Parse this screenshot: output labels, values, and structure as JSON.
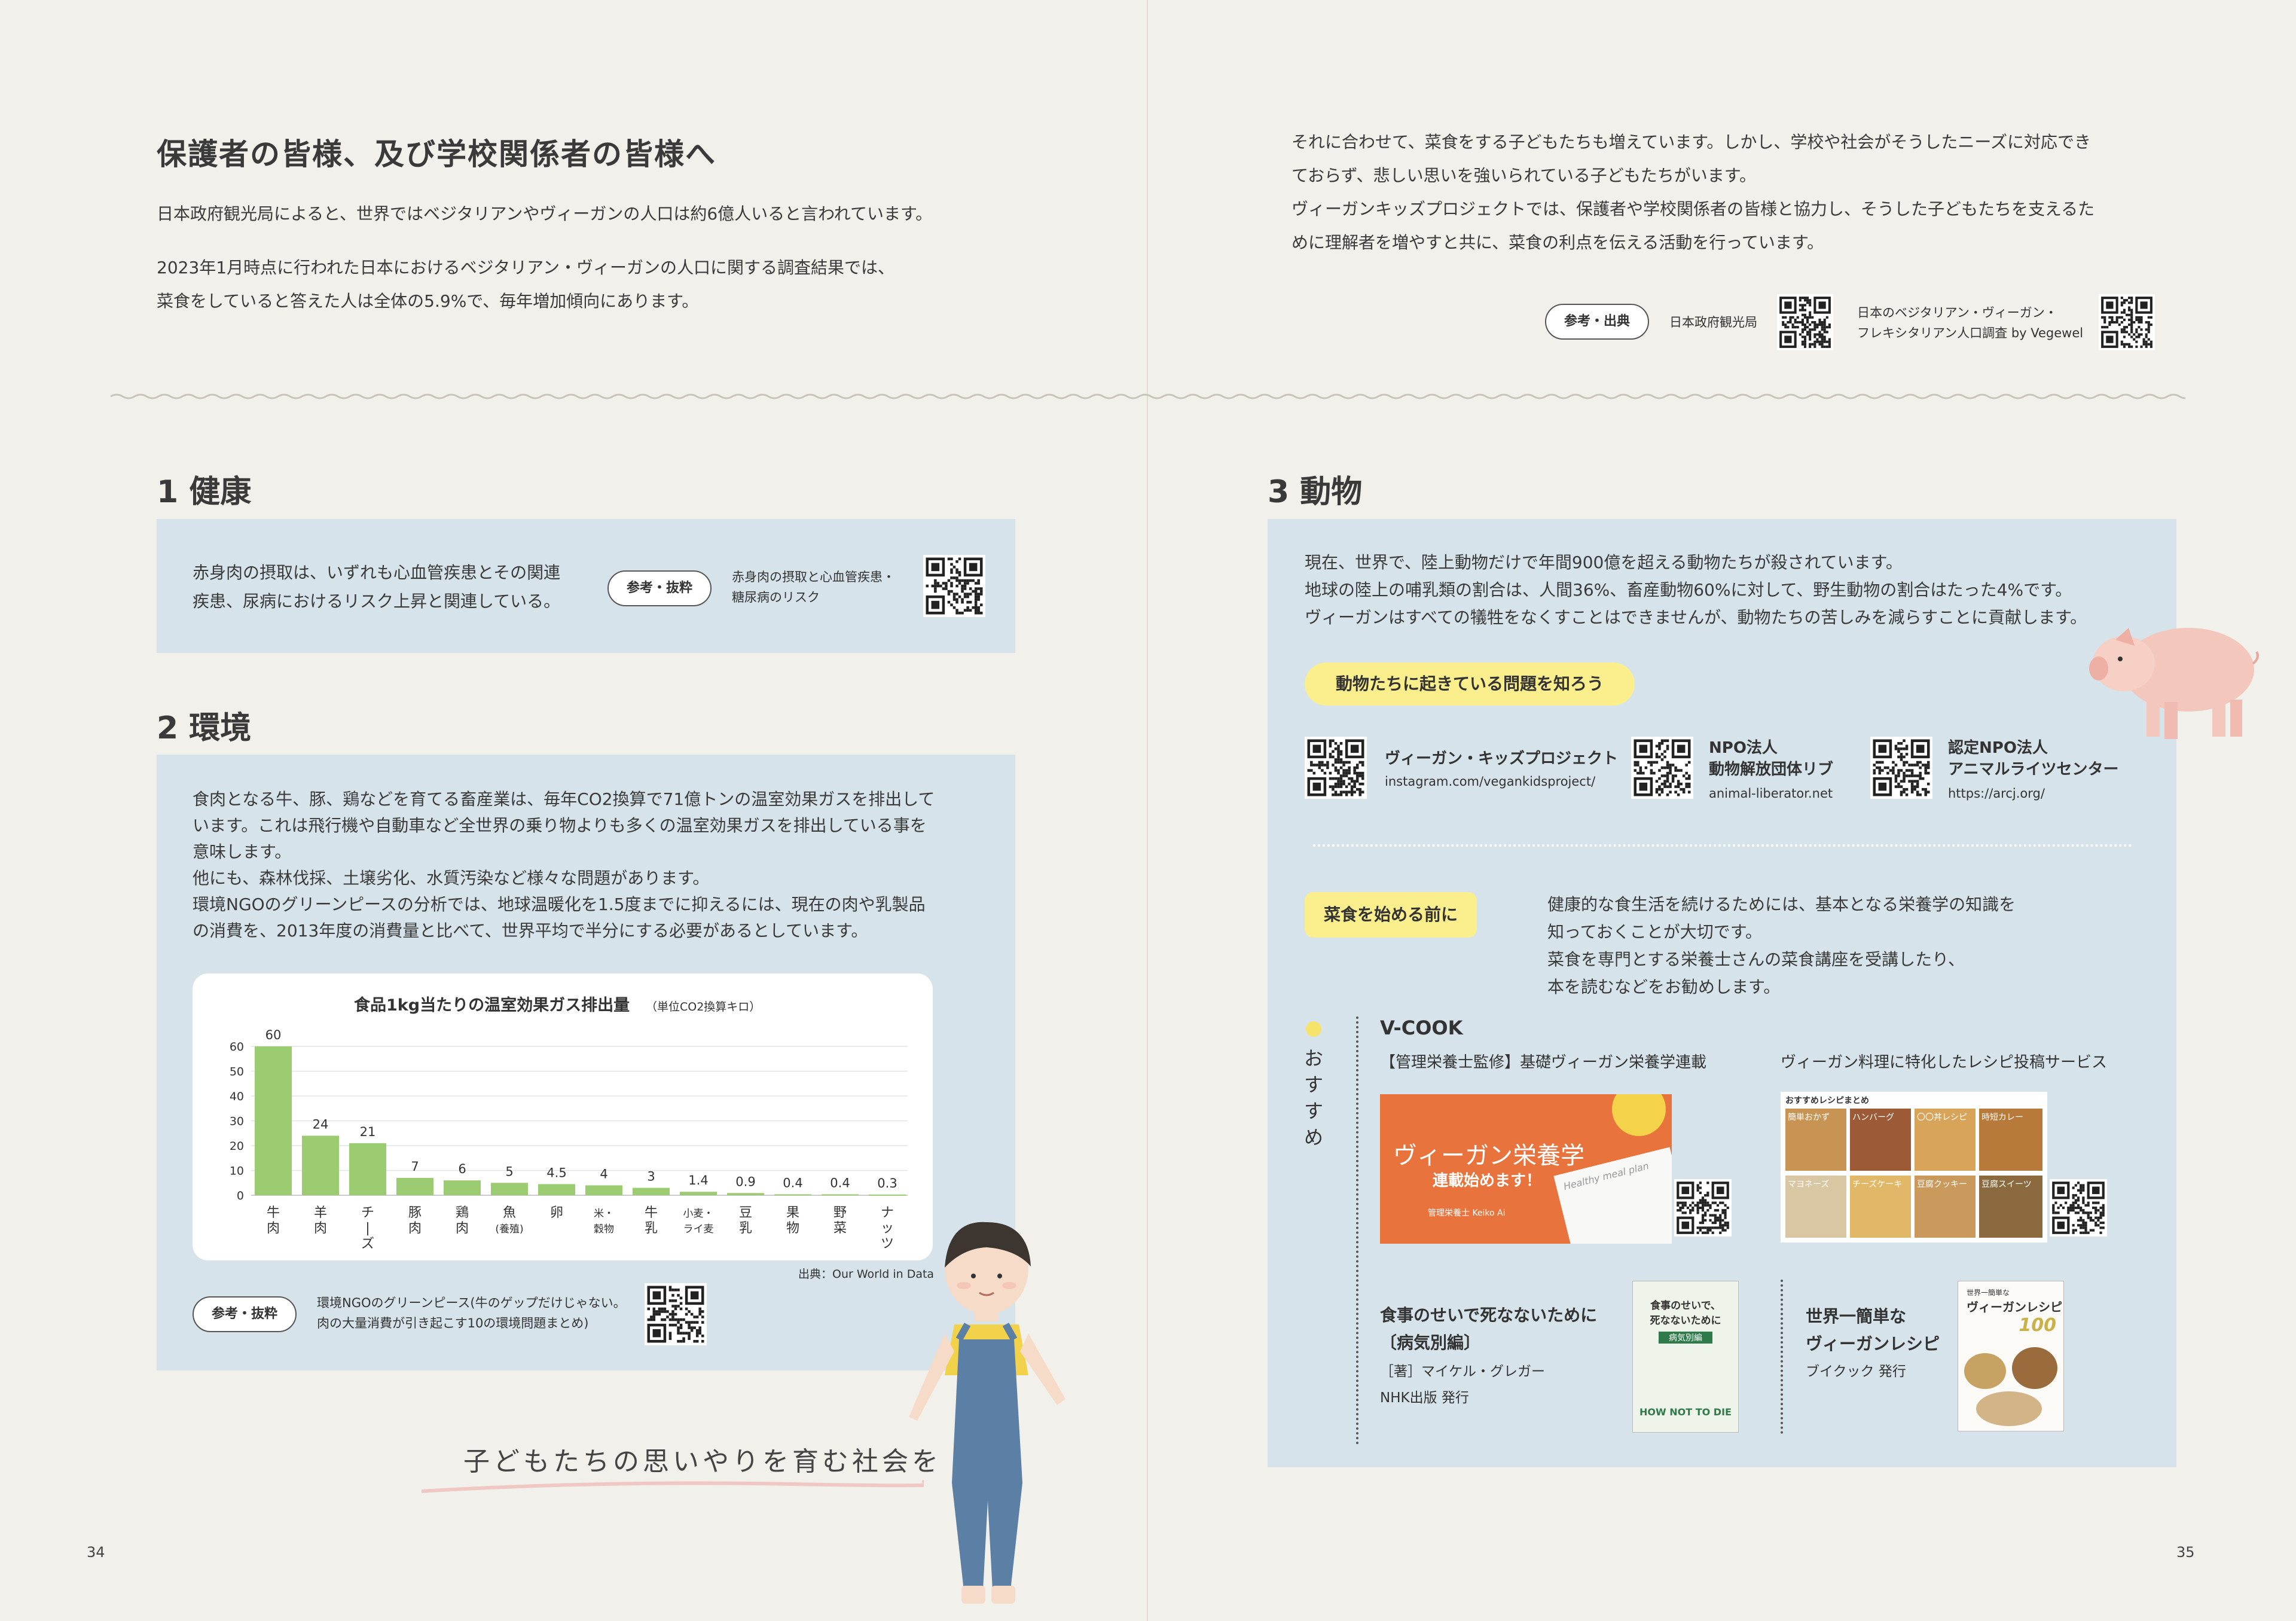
{
  "left": {
    "title": "保護者の皆様、及び学校関係者の皆様へ",
    "p1": "日本政府観光局によると、世界ではベジタリアンやヴィーガンの人口は約6億人いると言われています。",
    "p2a": "2023年1月時点に行われた日本におけるベジタリアン・ヴィーガンの人口に関する調査結果では、",
    "p2b": "菜食をしていると答えた人は全体の5.9%で、毎年増加傾向にあります。",
    "sec1": {
      "num": "1",
      "title": "健康",
      "text1": "赤身肉の摂取は、いずれも心血管疾患とその関連",
      "text2": "疾患、尿病におけるリスク上昇と関連している。",
      "pill": "参考・抜粋",
      "ref1": "赤身肉の摂取と心血管疾患・",
      "ref2": "糖尿病のリスク"
    },
    "sec2": {
      "num": "2",
      "title": "環境",
      "lines": [
        "食肉となる牛、豚、鶏などを育てる畜産業は、毎年CO2換算で71億トンの温室効果ガスを排出して",
        "います。これは飛行機や自動車など全世界の乗り物よりも多くの温室効果ガスを排出している事を",
        "意味します。",
        "他にも、森林伐採、土壌劣化、水質汚染など様々な問題があります。",
        "環境NGOのグリーンピースの分析では、地球温暖化を1.5度までに抑えるには、現在の肉や乳製品",
        "の消費を、2013年度の消費量と比べて、世界平均で半分にする必要があるとしています。"
      ],
      "source": "出典：Our World in Data",
      "pill": "参考・抜粋",
      "ref1": "環境NGOのグリーンピース(牛のゲップだけじゃない。",
      "ref2": "肉の大量消費が引き起こす10の環境問題まとめ)"
    },
    "tagline": "子どもたちの思いやりを育む社会を",
    "page": "34"
  },
  "chart_data": {
    "type": "bar",
    "title": "食品1kg当たりの温室効果ガス排出量",
    "unit": "（単位CO2換算キロ）",
    "categories": [
      "牛肉",
      "羊肉",
      "チーズ",
      "豚肉",
      "鶏肉",
      "魚(養殖)",
      "卵",
      "米・穀物",
      "牛乳",
      "小麦・ライ麦",
      "豆乳",
      "果物",
      "野菜",
      "ナッツ"
    ],
    "category_labels": [
      [
        "牛",
        "肉"
      ],
      [
        "羊",
        "肉"
      ],
      [
        "チ",
        "|",
        "ズ"
      ],
      [
        "豚",
        "肉"
      ],
      [
        "鶏",
        "肉"
      ],
      [
        "魚",
        "(養殖)"
      ],
      [
        "卵"
      ],
      [
        "米・",
        "穀物"
      ],
      [
        "牛",
        "乳"
      ],
      [
        "小麦・",
        "ライ麦"
      ],
      [
        "豆",
        "乳"
      ],
      [
        "果",
        "物"
      ],
      [
        "野",
        "菜"
      ],
      [
        "ナ",
        "ッ",
        "ツ"
      ]
    ],
    "values": [
      60,
      24,
      21,
      7,
      6,
      5,
      4.5,
      4,
      3,
      1.4,
      0.9,
      0.4,
      0.4,
      0.3
    ],
    "value_labels": [
      "60",
      "24",
      "21",
      "7",
      "6",
      "5",
      "4.5",
      "4",
      "3",
      "1.4",
      "0.9",
      "0.4",
      "0.4",
      "0.3"
    ],
    "yticks": [
      "0",
      "10",
      "20",
      "30",
      "40",
      "50",
      "60"
    ],
    "ylim": [
      0,
      60
    ],
    "bar_color": "#9ccc72",
    "grid": true
  },
  "right": {
    "intro1": "それに合わせて、菜食をする子どもたちも増えています。しかし、学校や社会がそうしたニーズに対応でき",
    "intro2": "ておらず、悲しい思いを強いられている子どもたちがいます。",
    "intro3": "ヴィーガンキッズプロジェクトでは、保護者や学校関係者の皆様と協力し、そうした子どもたちを支えるた",
    "intro4": "めに理解者を増やすと共に、菜食の利点を伝える活動を行っています。",
    "ref_pill": "参考・出典",
    "ref_a": "日本政府観光局",
    "ref_b1": "日本のベジタリアン・ヴィーガン・",
    "ref_b2": "フレキシタリアン人口調査 by Vegewel",
    "sec3": {
      "num": "3",
      "title": "動物",
      "t1": "現在、世界で、陸上動物だけで年間900億を超える動物たちが殺されています。",
      "t2": "地球の陸上の哺乳類の割合は、人間36%、畜産動物60%に対して、野生動物の割合はたった4%です。",
      "t3": "ヴィーガンはすべての犠牲をなくすことはできませんが、動物たちの苦しみを減らすことに貢献します。",
      "yellow1": "動物たちに起きている問題を知ろう",
      "org1_name": "ヴィーガン・キッズプロジェクト",
      "org1_url": "instagram.com/vegankidsproject/",
      "org2_name1": "NPO法人",
      "org2_name2": "動物解放団体リブ",
      "org2_url": "animal-liberator.net",
      "org3_name1": "認定NPO法人",
      "org3_name2": "アニマルライツセンター",
      "org3_url": "https://arcj.org/",
      "yellow2": "菜食を始める前に",
      "b1": "健康的な食生活を続けるためには、基本となる栄養学の知識を",
      "b2": "知っておくことが大切です。",
      "b3": "菜食を専門とする栄養士さんの菜食講座を受講したり、",
      "b4": "本を読むなどをお勧めします。",
      "osusume": [
        "お",
        "す",
        "す",
        "め"
      ],
      "vcook": "V-COOK",
      "vcook_a": "【管理栄養士監修】基礎ヴィーガン栄養学連載",
      "vcook_b": "ヴィーガン料理に特化したレシピ投稿サービス",
      "banner1": "ヴィーガン栄養学",
      "banner2": "連載始めます！",
      "banner3": "管理栄養士 Keiko Ai",
      "banner_note": "Healthy meal plan",
      "recipe_title": "おすすめレシピまとめ",
      "recipe_tags": [
        "簡単おかず",
        "ハンバーグ",
        "〇〇丼レシピ",
        "時短カレー",
        "",
        "",
        "マヨネーズ",
        "チーズケーキ",
        "豆腐クッキー",
        "豆腐スイーツ"
      ],
      "book1_t1": "食事のせいで死なないために",
      "book1_t2": "〔病気別編〕",
      "book1_t3": "［著］マイケル・グレガー",
      "book1_t4": "NHK出版 発行",
      "book1_cover1": "食事のせいで、",
      "book1_cover2": "死なないために",
      "book1_cover3": "病気別編",
      "book1_cover4": "HOW NOT TO DIE",
      "book2_t1": "世界一簡単な",
      "book2_t2": "ヴィーガンレシピ",
      "book2_t3": "ブイクック 発行",
      "book2_cover1": "世界一簡単な",
      "book2_cover2": "ヴィーガンレシピ",
      "book2_cover3": "100"
    },
    "page": "35"
  }
}
